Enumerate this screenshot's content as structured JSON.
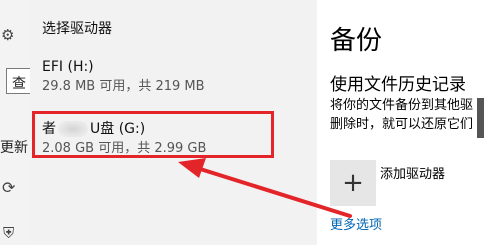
{
  "flyout": {
    "title": "选择驱动器",
    "drives": [
      {
        "name": "EFI (H:)",
        "info": "29.8 MB 可用，共 219 MB"
      },
      {
        "name_prefix": "者",
        "name_suffix": "U盘 (G:)",
        "info": "2.08 GB 可用，共 2.99 GB"
      }
    ]
  },
  "sidebar": {
    "search_glyph": "查",
    "partial_text": "更新"
  },
  "panel": {
    "title": "备份",
    "subtitle": "使用文件历史记录",
    "desc_line1": "将你的文件备份到其他驱",
    "desc_line2": "删除时，就可以还原它们",
    "add_drive_label": "添加驱动器",
    "more_options": "更多选项"
  },
  "colors": {
    "highlight": "#e3252a",
    "link": "#0066b4"
  }
}
